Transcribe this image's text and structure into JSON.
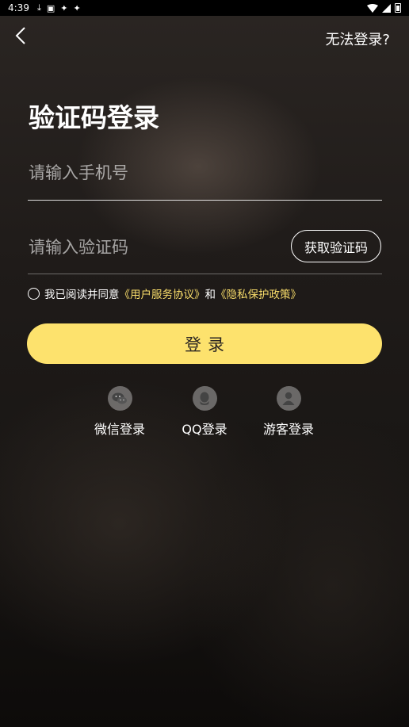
{
  "status_bar": {
    "time": "4:39",
    "icons": [
      "download-icon",
      "a-icon",
      "app-icon",
      "app-icon"
    ],
    "right_icons": [
      "wifi-icon",
      "signal-icon",
      "battery-icon"
    ]
  },
  "header": {
    "back_icon": "chevron-left-icon",
    "help_link": "无法登录?"
  },
  "title": "验证码登录",
  "phone": {
    "placeholder": "请输入手机号",
    "value": ""
  },
  "code": {
    "placeholder": "请输入验证码",
    "value": "",
    "button": "获取验证码"
  },
  "agreement": {
    "prefix": "我已阅读并同意",
    "link1": "《用户服务协议》",
    "and": "和",
    "link2": "《隐私保护政策》",
    "checked": false
  },
  "login_button": "登录",
  "social": [
    {
      "label": "微信登录",
      "icon": "wechat-icon"
    },
    {
      "label": "QQ登录",
      "icon": "qq-icon"
    },
    {
      "label": "游客登录",
      "icon": "guest-user-icon"
    }
  ],
  "colors": {
    "accent": "#fde26d",
    "link": "#f8dc6a",
    "background": "#1f1b19"
  }
}
